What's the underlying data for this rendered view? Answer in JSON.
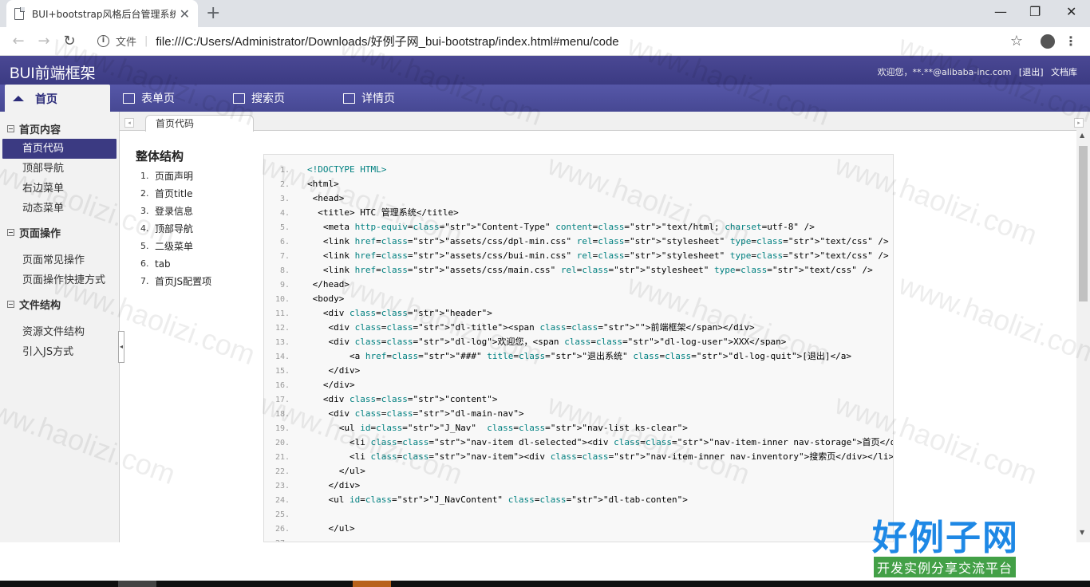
{
  "browser": {
    "tab_title": "BUI+bootstrap风格后台管理系统",
    "tab_close": "✕",
    "new_tab": "+",
    "win_min": "—",
    "win_max": "❐",
    "win_close": "✕",
    "back": "←",
    "forward": "→",
    "reload": "↻",
    "info_label": "文件",
    "url": "file:///C:/Users/Administrator/Downloads/好例子网_bui-bootstrap/index.html#menu/code",
    "star": "☆",
    "menu": "⋮"
  },
  "header": {
    "title": "BUI前端框架",
    "welcome": "欢迎您，**.**@alibaba-inc.com",
    "logout": "[退出]",
    "docs": "文档库"
  },
  "nav": [
    {
      "label": "首页",
      "icon": "home-icon",
      "selected": true
    },
    {
      "label": "表单页",
      "icon": "form-icon",
      "selected": false
    },
    {
      "label": "搜索页",
      "icon": "search-page-icon",
      "selected": false
    },
    {
      "label": "详情页",
      "icon": "detail-icon",
      "selected": false
    }
  ],
  "sidebar": {
    "groups": [
      {
        "title": "首页内容",
        "items": [
          "首页代码",
          "顶部导航",
          "右边菜单",
          "动态菜单"
        ]
      },
      {
        "title": "页面操作",
        "items": [
          "页面常见操作",
          "页面操作快捷方式"
        ]
      },
      {
        "title": "文件结构",
        "items": [
          "资源文件结构",
          "引入JS方式"
        ]
      }
    ],
    "active_item": "首页代码"
  },
  "content_tab": "首页代码",
  "outline": {
    "title": "整体结构",
    "items": [
      "页面声明",
      "首页title",
      "登录信息",
      "顶部导航",
      "二级菜单",
      "tab",
      "首页JS配置项"
    ]
  },
  "code_lines": [
    "<!DOCTYPE HTML>",
    "<html>",
    " <head>",
    "  <title> HTC 管理系统</title>",
    "   <meta http-equiv=\"Content-Type\" content=\"text/html; charset=utf-8\" />",
    "   <link href=\"assets/css/dpl-min.css\" rel=\"stylesheet\" type=\"text/css\" />",
    "   <link href=\"assets/css/bui-min.css\" rel=\"stylesheet\" type=\"text/css\" />",
    "   <link href=\"assets/css/main.css\" rel=\"stylesheet\" type=\"text/css\" />",
    " </head>",
    " <body>",
    "   <div class=\"header\">",
    "    <div class=\"dl-title\"><span class=\"\">前端框架</span></div>",
    "    <div class=\"dl-log\">欢迎您，<span class=\"dl-log-user\">XXX</span>",
    "        <a href=\"###\" title=\"退出系统\" class=\"dl-log-quit\">[退出]</a>",
    "    </div>",
    "   </div>",
    "   <div class=\"content\">",
    "    <div class=\"dl-main-nav\">",
    "      <ul id=\"J_Nav\"  class=\"nav-list ks-clear\">",
    "        <li class=\"nav-item dl-selected\"><div class=\"nav-item-inner nav-storage\">首页</div></li>",
    "        <li class=\"nav-item\"><div class=\"nav-item-inner nav-inventory\">搜索页</div></li>",
    "      </ul>",
    "    </div>",
    "    <ul id=\"J_NavContent\" class=\"dl-tab-conten\">",
    "",
    "    </ul>"
  ],
  "watermark": "www.haolizi.com",
  "brand": {
    "main": "好例子网",
    "sub": "开发实例分享交流平台"
  },
  "colors": {
    "header": "#3b3a82",
    "active": "#3b3a82",
    "attr": "#008080",
    "string": "#b22222"
  }
}
